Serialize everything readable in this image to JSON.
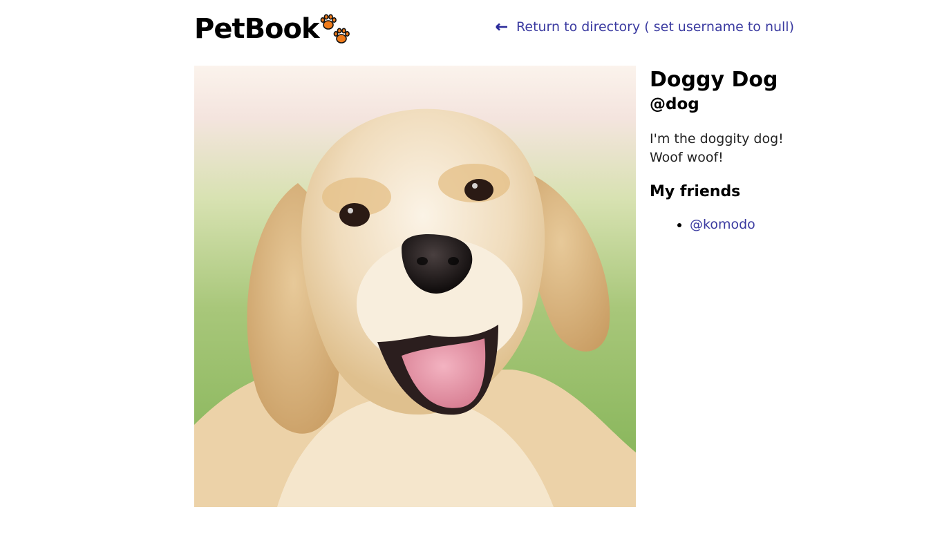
{
  "header": {
    "brand": "PetBook",
    "logo_icon": "paw-prints-icon",
    "back_link_label": "Return to directory ( set username to null)",
    "back_link_icon": "arrow-left-icon"
  },
  "profile": {
    "name": "Doggy Dog",
    "handle": "@dog",
    "bio": "I'm the doggity dog!\nWoof woof!",
    "photo_subject": "golden retriever"
  },
  "friends": {
    "heading": "My friends",
    "items": [
      {
        "handle": "@komodo"
      }
    ]
  },
  "colors": {
    "link": "#3a3aa0",
    "paw_orange": "#f07b1a",
    "text": "#111111"
  }
}
